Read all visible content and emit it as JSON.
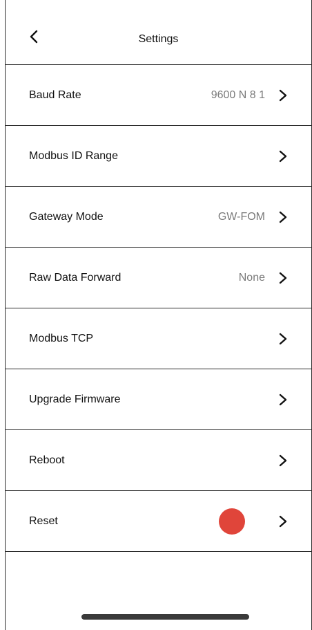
{
  "header": {
    "title": "Settings",
    "back_icon": "chevron-left-icon"
  },
  "rows": [
    {
      "label": "Baud Rate",
      "value": "9600 N 8 1"
    },
    {
      "label": "Modbus ID Range",
      "value": ""
    },
    {
      "label": "Gateway Mode",
      "value": "GW-FOM"
    },
    {
      "label": "Raw Data Forward",
      "value": "None"
    },
    {
      "label": "Modbus TCP",
      "value": ""
    },
    {
      "label": "Upgrade Firmware",
      "value": ""
    },
    {
      "label": "Reboot",
      "value": ""
    },
    {
      "label": "Reset",
      "value": "",
      "indicator_color": "#e0453a"
    }
  ],
  "row_icon": "chevron-right-icon",
  "colors": {
    "value_text": "#7a7a7a",
    "divider": "#2a2a2a",
    "reset_indicator": "#e0453a"
  }
}
